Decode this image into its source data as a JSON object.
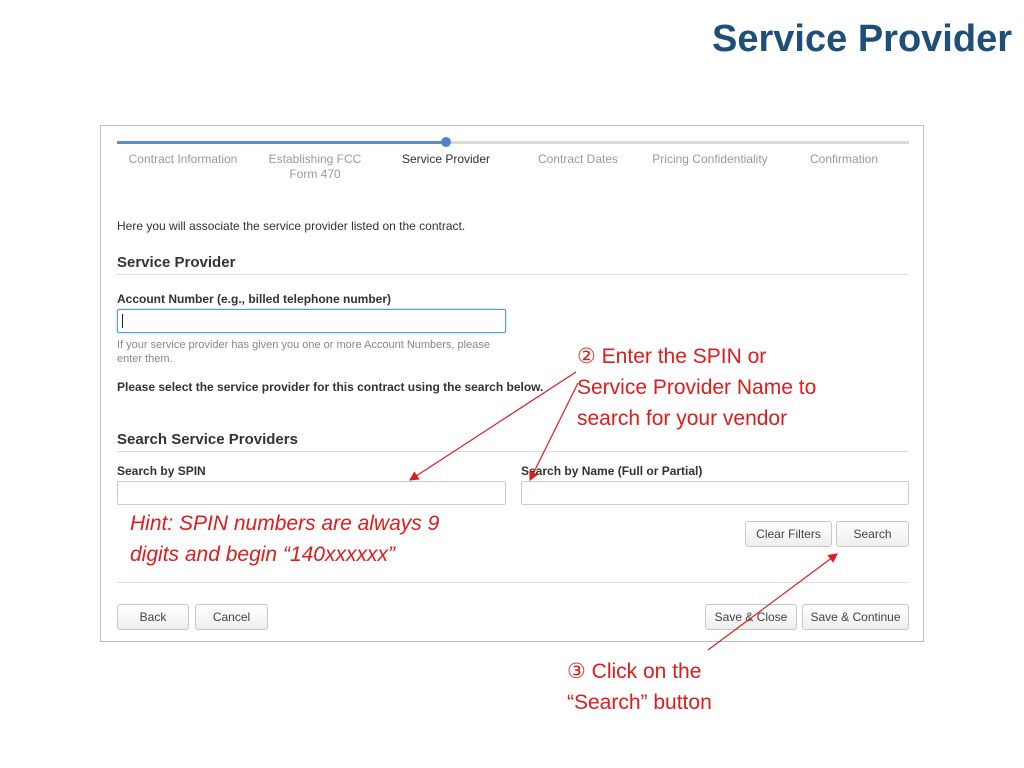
{
  "slide": {
    "title": "Service Provider"
  },
  "wizard": {
    "steps": [
      {
        "label": "Contract Information"
      },
      {
        "label": "Establishing FCC Form 470"
      },
      {
        "label": "Service Provider"
      },
      {
        "label": "Contract Dates"
      },
      {
        "label": "Pricing Confidentiality"
      },
      {
        "label": "Confirmation"
      }
    ],
    "active_step": "Service Provider",
    "progress_fraction": 0.42
  },
  "form": {
    "intro": "Here you will associate the service provider listed on the contract.",
    "service_provider_heading": "Service Provider",
    "account_number": {
      "label": "Account Number (e.g., billed telephone number)",
      "value": "",
      "help": "If your service provider has given you one or more Account Numbers, please enter them."
    },
    "select_instruction": "Please select the service provider for this contract using the search below.",
    "search_heading": "Search Service Providers",
    "search_spin": {
      "label": "Search by SPIN",
      "value": ""
    },
    "search_name": {
      "label": "Search by Name (Full or Partial)",
      "value": ""
    },
    "buttons": {
      "clear_filters": "Clear Filters",
      "search": "Search",
      "back": "Back",
      "cancel": "Cancel",
      "save_close": "Save & Close",
      "save_continue": "Save & Continue"
    }
  },
  "annotations": {
    "step2_marker": "②",
    "step2_text": [
      "Enter the SPIN or",
      "Service Provider Name to",
      "search for your vendor"
    ],
    "hint_lines": [
      "Hint:  SPIN numbers are always 9",
      "digits and begin “140xxxxxx”"
    ],
    "step3_marker": "③",
    "step3_text": [
      "Click on the",
      "“Search” button"
    ]
  },
  "colors": {
    "title": "#1f4e79",
    "annotation": "#e01b1b",
    "progress": "#5b8fc9"
  }
}
